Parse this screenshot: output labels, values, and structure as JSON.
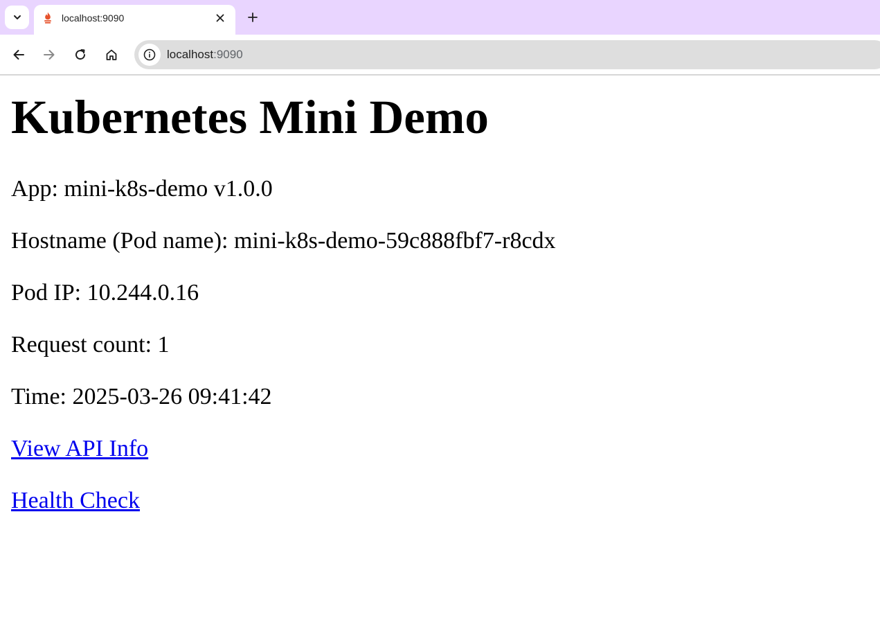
{
  "browser": {
    "tab": {
      "title": "localhost:9090",
      "favicon": "flame-icon"
    },
    "address_bar": {
      "host": "localhost",
      "port": ":9090"
    },
    "colors": {
      "tabstrip": "#e9d5ff",
      "omnibox": "#dedede",
      "favicon": "#e6522c"
    }
  },
  "page": {
    "title": "Kubernetes Mini Demo",
    "lines": {
      "app": "App: mini-k8s-demo v1.0.0",
      "hostname": "Hostname (Pod name): mini-k8s-demo-59c888fbf7-r8cdx",
      "pod_ip": "Pod IP: 10.244.0.16",
      "request_count": "Request count: 1",
      "time": "Time: 2025-03-26 09:41:42"
    },
    "links": {
      "api_info": "View API Info",
      "health": "Health Check"
    },
    "colors": {
      "link": "#0000ee"
    }
  }
}
